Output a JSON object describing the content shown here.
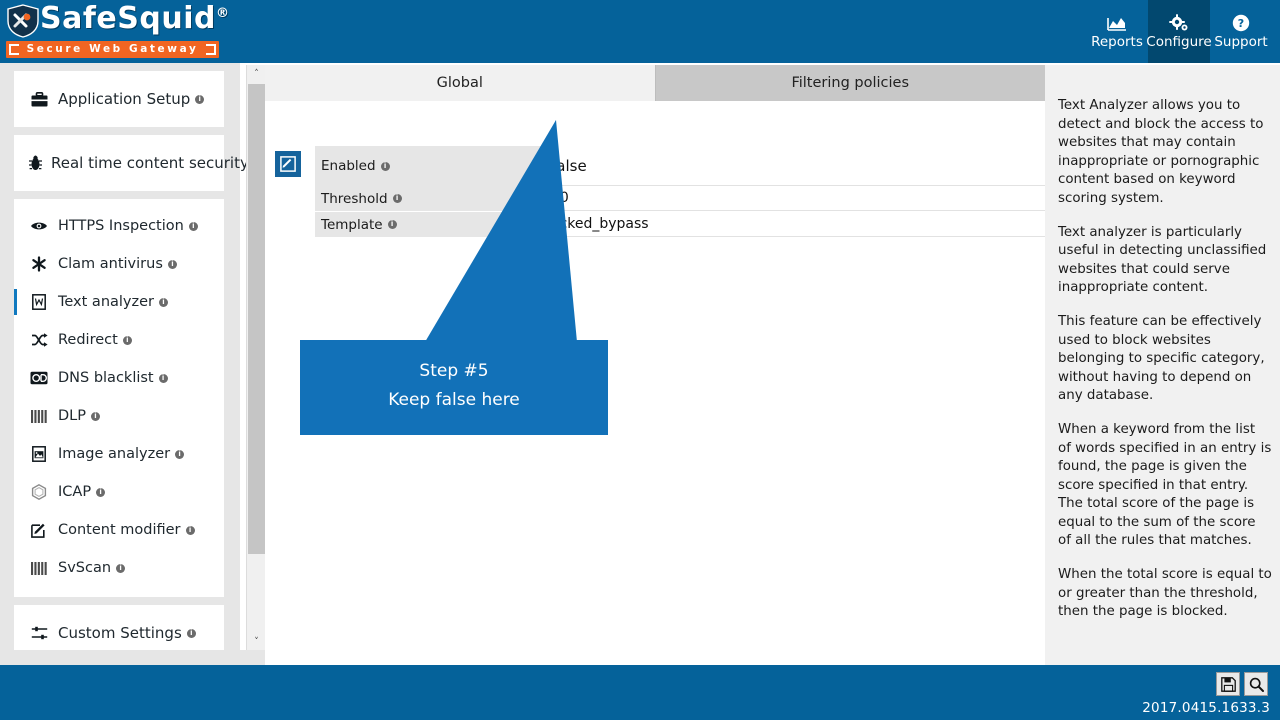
{
  "header": {
    "logo_text": "SafeSquid",
    "logo_reg": "®",
    "tagline": "Secure Web Gateway",
    "nav": [
      {
        "label": "Reports",
        "icon": "chart-icon",
        "active": false
      },
      {
        "label": "Configure",
        "icon": "gear-icon",
        "active": true
      },
      {
        "label": "Support",
        "icon": "question-icon",
        "active": false
      }
    ]
  },
  "sidebar": {
    "groups": [
      {
        "items": [
          {
            "label": "Application Setup",
            "icon": "briefcase-icon",
            "info": "i",
            "active": false
          }
        ]
      },
      {
        "items": [
          {
            "label": "Real time content security",
            "icon": "bug-icon",
            "info": "i",
            "active": false
          }
        ]
      },
      {
        "items": [
          {
            "label": "HTTPS Inspection",
            "icon": "eye-icon",
            "info": "i",
            "active": false
          },
          {
            "label": "Clam antivirus",
            "icon": "asterisk-icon",
            "info": "i",
            "active": false
          },
          {
            "label": "Text analyzer",
            "icon": "document-text-icon",
            "info": "i",
            "active": true
          },
          {
            "label": "Redirect",
            "icon": "shuffle-icon",
            "info": "i",
            "active": false
          },
          {
            "label": "DNS blacklist",
            "icon": "dns-icon",
            "info": "i",
            "active": false
          },
          {
            "label": "DLP",
            "icon": "bars-icon",
            "info": "i",
            "active": false
          },
          {
            "label": "Image analyzer",
            "icon": "image-icon",
            "info": "i",
            "active": false
          },
          {
            "label": "ICAP",
            "icon": "hexagon-icon",
            "info": "i",
            "active": false
          },
          {
            "label": "Content modifier",
            "icon": "edit-icon",
            "info": "i",
            "active": false
          },
          {
            "label": "SvScan",
            "icon": "bars-icon",
            "info": "i",
            "active": false
          }
        ]
      },
      {
        "items": [
          {
            "label": "Custom Settings",
            "icon": "sliders-icon",
            "info": "i",
            "active": false
          }
        ]
      }
    ]
  },
  "main": {
    "tabs": [
      {
        "label": "Global",
        "active": true
      },
      {
        "label": "Filtering policies",
        "active": false
      }
    ],
    "edit_icon": "edit-pencil-icon",
    "fields": [
      {
        "label": "Enabled",
        "info": "i",
        "value": "false"
      },
      {
        "label": "Threshold",
        "info": "i",
        "value": "00"
      },
      {
        "label": "Template",
        "info": "i",
        "value": "ocked_bypass"
      }
    ]
  },
  "callout": {
    "line1": "Step #5",
    "line2": "Keep false here",
    "color": "#1271b8"
  },
  "help": {
    "paragraphs": [
      "Text Analyzer allows you to detect and block the access to websites that may contain inappropriate or pornographic content based on keyword scoring system.",
      "Text analyzer is particularly useful in detecting unclassified websites that could serve inappropriate content.",
      "This feature can be effectively used to block websites belonging to specific category, without having to depend on any database.",
      "When a keyword from the list of words specified in an entry is found, the page is given the score specified in that entry. The total score of the page is equal to the sum of the score of all the rules that matches.",
      "When the total score is equal to or greater than the threshold, then the page is blocked."
    ]
  },
  "footer": {
    "buttons": [
      {
        "name": "save-icon",
        "glyph": "💾"
      },
      {
        "name": "search-icon",
        "glyph": "🔍"
      }
    ],
    "version": "2017.0415.1633.3"
  },
  "scrollbar": {
    "up": "˄",
    "down": "˅"
  },
  "colors": {
    "brand_blue": "#05629a",
    "accent_orange": "#f16522",
    "callout_blue": "#1271b8",
    "active_nav": "#02486f"
  }
}
